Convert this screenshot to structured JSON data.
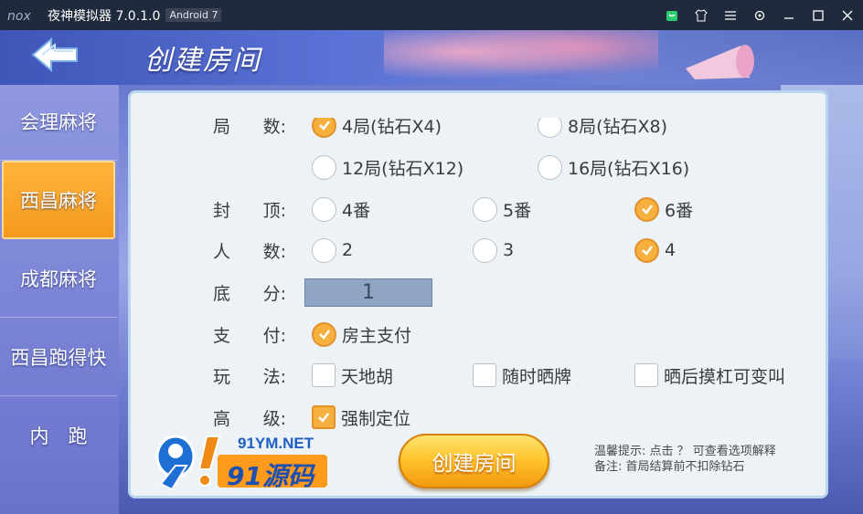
{
  "window": {
    "app_title": "夜神模拟器 7.0.1.0",
    "android_badge": "Android 7",
    "icons": [
      "nox-logo-icon",
      "shop-icon",
      "shirt-icon",
      "menu-icon",
      "gear-icon",
      "minimize-icon",
      "maximize-icon",
      "close-icon"
    ]
  },
  "header": {
    "title": "创建房间"
  },
  "side_menu": {
    "items": [
      {
        "label": "会理麻将",
        "active": false
      },
      {
        "label": "西昌麻将",
        "active": true
      },
      {
        "label": "成都麻将",
        "active": false
      },
      {
        "label": "西昌跑得快",
        "active": false
      },
      {
        "label": "内　跑",
        "active": false
      }
    ]
  },
  "form": {
    "rounds": {
      "label_a": "局",
      "label_b": "数:",
      "options": [
        {
          "text": "4局(钻石X4)",
          "selected": true
        },
        {
          "text": "8局(钻石X8)",
          "selected": false
        },
        {
          "text": "12局(钻石X12)",
          "selected": false
        },
        {
          "text": "16局(钻石X16)",
          "selected": false
        }
      ]
    },
    "cap": {
      "label_a": "封",
      "label_b": "顶:",
      "options": [
        {
          "text": "4番",
          "selected": false
        },
        {
          "text": "5番",
          "selected": false
        },
        {
          "text": "6番",
          "selected": true
        }
      ]
    },
    "players": {
      "label_a": "人",
      "label_b": "数:",
      "options": [
        {
          "text": "2",
          "selected": false
        },
        {
          "text": "3",
          "selected": false
        },
        {
          "text": "4",
          "selected": true
        }
      ]
    },
    "base_score": {
      "label_a": "底",
      "label_b": "分:",
      "value": "1"
    },
    "payment": {
      "label_a": "支",
      "label_b": "付:",
      "options": [
        {
          "text": "房主支付",
          "selected": true
        }
      ]
    },
    "rules": {
      "label_a": "玩",
      "label_b": "法:",
      "options": [
        {
          "text": "天地胡",
          "checked": false
        },
        {
          "text": "随时晒牌",
          "checked": false
        },
        {
          "text": "晒后摸杠可变叫",
          "checked": false
        }
      ]
    },
    "advanced": {
      "label_a": "高",
      "label_b": "级:",
      "options": [
        {
          "text": "强制定位",
          "checked": true
        }
      ]
    }
  },
  "footer": {
    "logo_top": "91YM.NET",
    "logo_main": "91源码",
    "create_button": "创建房间",
    "hint_line1": "温馨提示: 点击 ？ 可查看选项解释",
    "hint_line2": "备注: 首局结算前不扣除钻石"
  },
  "colors": {
    "accent_orange": "#f6b03d",
    "panel_bg": "#ecf2f6",
    "active_menu": "#ffb33b"
  }
}
